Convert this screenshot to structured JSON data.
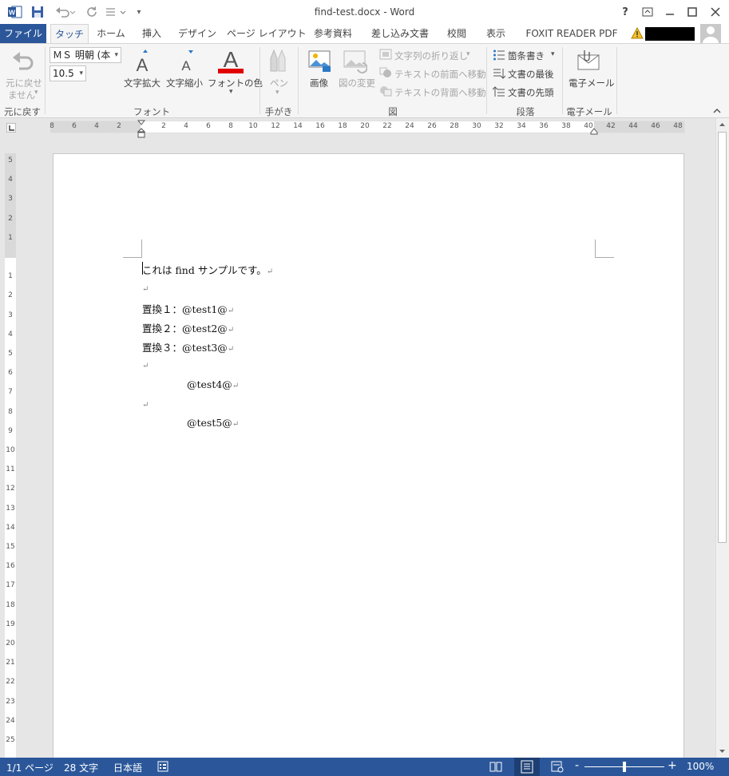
{
  "window": {
    "title": "find-test.docx - Word",
    "help": "?",
    "buttons": {
      "ribbon_display": "ribbon-display-icon",
      "minimize": "minimize-icon",
      "maximize": "maximize-icon",
      "close": "close-icon"
    }
  },
  "tabs": [
    {
      "label": "ファイル"
    },
    {
      "label": "タッチ"
    },
    {
      "label": "ホーム"
    },
    {
      "label": "挿入"
    },
    {
      "label": "デザイン"
    },
    {
      "label": "ページ レイアウト"
    },
    {
      "label": "参考資料"
    },
    {
      "label": "差し込み文書"
    },
    {
      "label": "校閲"
    },
    {
      "label": "表示"
    },
    {
      "label": "FOXIT READER PDF"
    }
  ],
  "ribbon": {
    "undo": {
      "line1": "元に戻せ",
      "line2": "ません",
      "group": "元に戻す"
    },
    "font": {
      "name": "ＭＳ 明朝 (本",
      "size": "10.5",
      "grow": "文字拡大",
      "shrink": "文字縮小",
      "color": "フォントの色",
      "group": "フォント",
      "color_value": "#e00000"
    },
    "pen": {
      "label": "ペン",
      "group": "手がき"
    },
    "figure": {
      "image": "画像",
      "change": "図の変更",
      "wrap": "文字列の折り返し",
      "front": "テキストの前面へ移動",
      "back": "テキストの背面へ移動",
      "group": "図"
    },
    "paragraph": {
      "bullets": "箇条書き",
      "doc_end": "文書の最後",
      "doc_start": "文書の先頭",
      "group": "段落"
    },
    "email": {
      "label": "電子メール",
      "group": "電子メール"
    }
  },
  "ruler": {
    "h_left": [
      "8",
      "6",
      "4",
      "2"
    ],
    "h_right": [
      "2",
      "4",
      "6",
      "8",
      "10",
      "12",
      "14",
      "16",
      "18",
      "20",
      "22",
      "24",
      "26",
      "28",
      "30",
      "32",
      "34",
      "36",
      "38",
      "40",
      "42",
      "44",
      "46",
      "48"
    ],
    "v_top": [
      "5",
      "4",
      "3",
      "2",
      "1"
    ],
    "v_body": [
      "1",
      "2",
      "3",
      "4",
      "5",
      "6",
      "7",
      "8",
      "9",
      "10",
      "11",
      "12",
      "13",
      "14",
      "15",
      "16",
      "17",
      "18",
      "19",
      "20",
      "21",
      "22",
      "23",
      "24",
      "25"
    ]
  },
  "document": {
    "lines": [
      {
        "text": "これは find サンプルです。",
        "indent": false
      },
      {
        "text": "",
        "indent": false
      },
      {
        "text": "置換１：@test1@",
        "indent": false
      },
      {
        "text": "置換２：@test2@",
        "indent": false
      },
      {
        "text": "置換３：@test3@",
        "indent": false
      },
      {
        "text": "",
        "indent": false
      },
      {
        "text": "@test4@",
        "indent": true
      },
      {
        "text": "",
        "indent": false
      },
      {
        "text": "@test5@",
        "indent": true
      }
    ],
    "para_mark": "↵"
  },
  "status": {
    "page": "1/1 ページ",
    "words": "28 文字",
    "language": "日本語",
    "zoom": "100%",
    "minus": "-",
    "plus": "+"
  },
  "colors": {
    "accent": "#2b579a",
    "ribbon_bg": "#f5f5f5"
  }
}
